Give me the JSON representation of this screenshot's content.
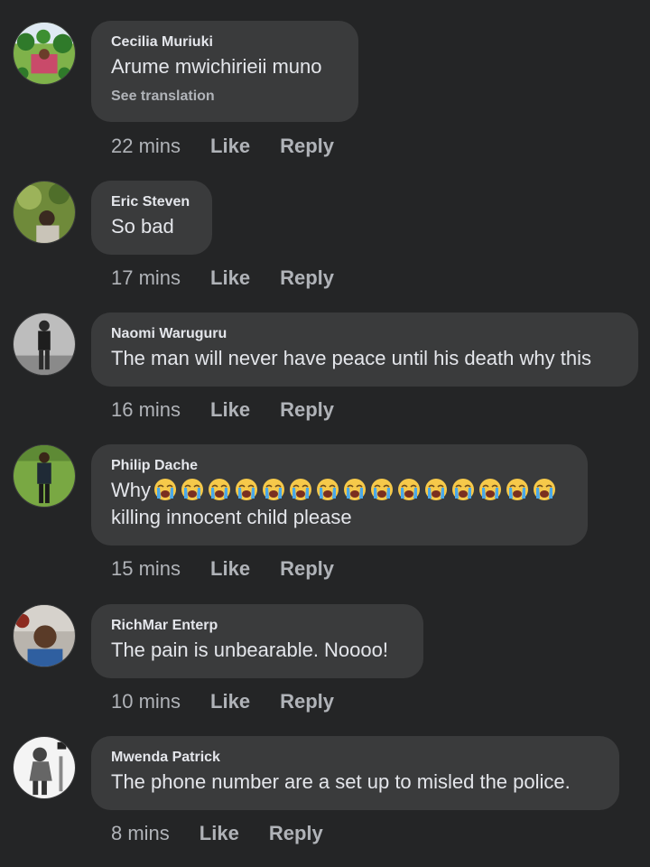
{
  "comments": [
    {
      "author": "Cecilia Muriuki",
      "text": "Arume mwichirieii muno",
      "see_translation": "See translation",
      "time": "22 mins",
      "like": "Like",
      "reply": "Reply"
    },
    {
      "author": "Eric Steven",
      "text": "So bad",
      "time": "17 mins",
      "like": "Like",
      "reply": "Reply"
    },
    {
      "author": "Naomi Waruguru",
      "text": "The man will never have peace until his death why this",
      "time": "16 mins",
      "like": "Like",
      "reply": "Reply"
    },
    {
      "author": "Philip Dache",
      "text_line1": "Why",
      "emoji": "loudly-crying-face-emoji",
      "emoji_count": 15,
      "text_line2": "killing innocent child please",
      "time": "15 mins",
      "like": "Like",
      "reply": "Reply"
    },
    {
      "author": "RichMar Enterp",
      "text": "The pain is unbearable. Noooo!",
      "time": "10 mins",
      "like": "Like",
      "reply": "Reply"
    },
    {
      "author": "Mwenda Patrick",
      "text": "The phone number are a set up to misled the police.",
      "time": "8 mins",
      "like": "Like",
      "reply": "Reply"
    }
  ],
  "colors": {
    "background": "#242526",
    "bubble": "#3a3b3c",
    "primary_text": "#e4e6eb",
    "secondary_text": "#b0b3b8"
  }
}
